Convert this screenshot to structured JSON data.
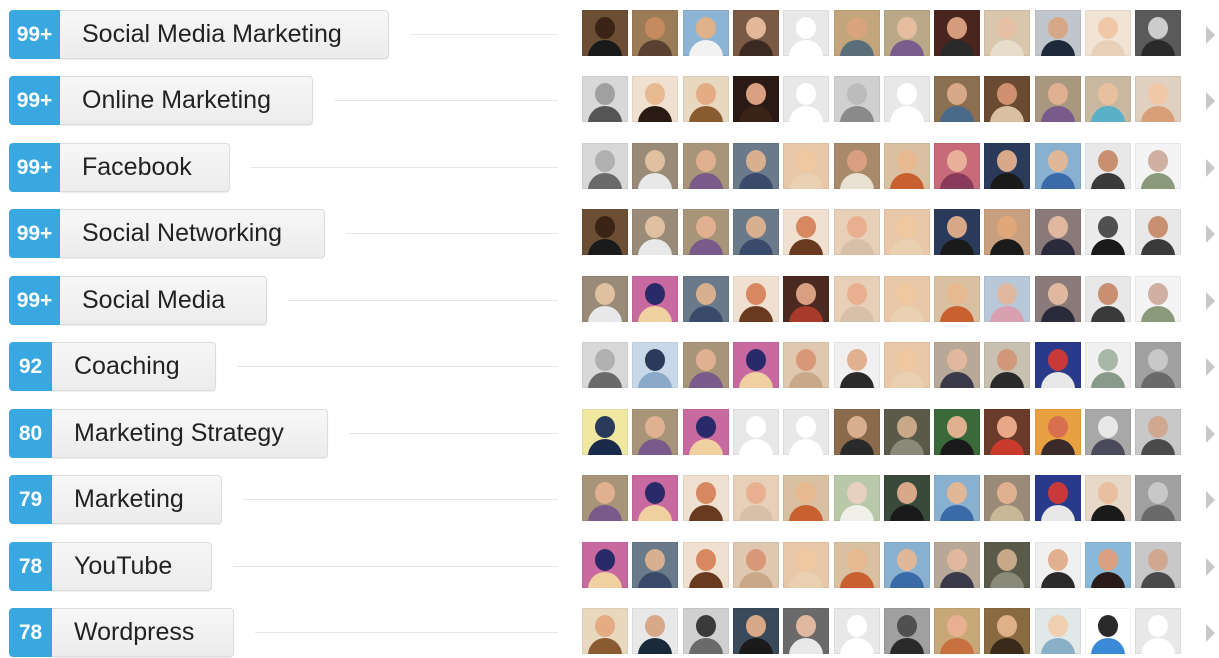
{
  "skills": [
    {
      "count": "99+",
      "name": "Social Media Marketing",
      "photos": [
        {
          "bg": "#6b4e34",
          "skin": "#3b2416",
          "shirt": "#1a1a1a"
        },
        {
          "bg": "#9c7b57",
          "skin": "#c68a5e",
          "shirt": "#5a4030"
        },
        {
          "bg": "#8db4d4",
          "skin": "#e0b28c",
          "shirt": "#f2f2f2"
        },
        {
          "bg": "#7a5a45",
          "skin": "#e2b79a",
          "shirt": "#3b2a22"
        },
        {
          "placeholder": true
        },
        {
          "bg": "#c4a47a",
          "skin": "#d8a47e",
          "shirt": "#5a6e7a"
        },
        {
          "bg": "#bba889",
          "skin": "#e5bea0",
          "shirt": "#7a5d8c"
        },
        {
          "bg": "#4a2520",
          "skin": "#d49c7c",
          "shirt": "#2a2a2a"
        },
        {
          "bg": "#d8c6ad",
          "skin": "#e6c0a4",
          "shirt": "#e8dccb"
        },
        {
          "bg": "#c0c6cc",
          "skin": "#d6a888",
          "shirt": "#1e2a3a"
        },
        {
          "bg": "#f2e4d4",
          "skin": "#f0c8a8",
          "shirt": "#e8d0b8"
        },
        {
          "bg": "#5a5a5a",
          "skin": "#cccccc",
          "shirt": "#2a2a2a"
        }
      ]
    },
    {
      "count": "99+",
      "name": "Online Marketing",
      "photos": [
        {
          "bg": "#d8d8d8",
          "skin": "#a0a0a0",
          "shirt": "#555555"
        },
        {
          "bg": "#f0e0d0",
          "skin": "#e8b890",
          "shirt": "#2a1a14"
        },
        {
          "bg": "#e8d8c0",
          "skin": "#e4ac84",
          "shirt": "#8a5a30"
        },
        {
          "bg": "#2a1a14",
          "skin": "#d8a080",
          "shirt": "#3a2418"
        },
        {
          "placeholder": true
        },
        {
          "bg": "#d0d0d0",
          "skin": "#bcbcbc",
          "shirt": "#8a8a8a"
        },
        {
          "placeholder": true
        },
        {
          "bg": "#8a7050",
          "skin": "#d8a888",
          "shirt": "#4a6a8a"
        },
        {
          "bg": "#6a4a30",
          "skin": "#d09070",
          "shirt": "#d8c0a0"
        },
        {
          "bg": "#a89880",
          "skin": "#e0b090",
          "shirt": "#7a5a8a"
        },
        {
          "bg": "#c8b8a0",
          "skin": "#e8c0a0",
          "shirt": "#5ab0c8"
        },
        {
          "bg": "#e0d0c0",
          "skin": "#f0c8a8",
          "shirt": "#d8a078"
        }
      ]
    },
    {
      "count": "99+",
      "name": "Facebook",
      "photos": [
        {
          "bg": "#d8d8d8",
          "skin": "#b0b0b0",
          "shirt": "#6a6a6a"
        },
        {
          "bg": "#9a8a78",
          "skin": "#e0c0a0",
          "shirt": "#e8e8e8"
        },
        {
          "bg": "#a89478",
          "skin": "#e0b090",
          "shirt": "#7a5a8a"
        },
        {
          "bg": "#6a7a8a",
          "skin": "#d8b090",
          "shirt": "#3a4a6a"
        },
        {
          "bg": "#e8c8a8",
          "skin": "#f0c8a0",
          "shirt": "#e8d0b0"
        },
        {
          "bg": "#a88a6a",
          "skin": "#d8a080",
          "shirt": "#e8e0d0"
        },
        {
          "bg": "#d8c0a0",
          "skin": "#e8b890",
          "shirt": "#c86030"
        },
        {
          "bg": "#c86a7a",
          "skin": "#e8b098",
          "shirt": "#8a3a5a"
        },
        {
          "bg": "#2a3a5a",
          "skin": "#d8a888",
          "shirt": "#1a1a1a"
        },
        {
          "bg": "#8ab0d0",
          "skin": "#e0b898",
          "shirt": "#3a6aa8"
        },
        {
          "bg": "#e8e8e8",
          "skin": "#c89070",
          "shirt": "#3a3a3a"
        },
        {
          "bg": "#f4f4f4",
          "skin": "#d0b0a0",
          "shirt": "#8a9a7a"
        }
      ]
    },
    {
      "count": "99+",
      "name": "Social Networking",
      "photos": [
        {
          "bg": "#6b4e34",
          "skin": "#3b2416",
          "shirt": "#1a1a1a"
        },
        {
          "bg": "#9a8a78",
          "skin": "#e0c0a0",
          "shirt": "#e8e8e8"
        },
        {
          "bg": "#a89478",
          "skin": "#e0b090",
          "shirt": "#7a5a8a"
        },
        {
          "bg": "#6a7a8a",
          "skin": "#d8b090",
          "shirt": "#3a4a6a"
        },
        {
          "bg": "#f0e0d0",
          "skin": "#d88860",
          "shirt": "#6a3a20"
        },
        {
          "bg": "#e8d0b8",
          "skin": "#e8b090",
          "shirt": "#d8c0a8"
        },
        {
          "bg": "#e8c8a8",
          "skin": "#f0c8a0",
          "shirt": "#e8d0b0"
        },
        {
          "bg": "#2a3a5a",
          "skin": "#d8a888",
          "shirt": "#1a1a1a"
        },
        {
          "bg": "#c8a080",
          "skin": "#e0a878",
          "shirt": "#1a1a1a"
        },
        {
          "bg": "#8a7a7a",
          "skin": "#e0b8a0",
          "shirt": "#2a2a3a"
        },
        {
          "bg": "#ececec",
          "skin": "#505050",
          "shirt": "#1a1a1a"
        },
        {
          "bg": "#e8e8e8",
          "skin": "#c89070",
          "shirt": "#3a3a3a"
        }
      ]
    },
    {
      "count": "99+",
      "name": "Social Media",
      "photos": [
        {
          "bg": "#9a8a78",
          "skin": "#e0c0a0",
          "shirt": "#e8e8e8"
        },
        {
          "bg": "#c86aa0",
          "skin": "#2a2a6a",
          "shirt": "#f0d0a0"
        },
        {
          "bg": "#6a7a8a",
          "skin": "#d8b090",
          "shirt": "#3a4a6a"
        },
        {
          "bg": "#f0e0d0",
          "skin": "#d88860",
          "shirt": "#6a3a20"
        },
        {
          "bg": "#4a2a20",
          "skin": "#d8a080",
          "shirt": "#a83a2a"
        },
        {
          "bg": "#e8d0b8",
          "skin": "#e8b090",
          "shirt": "#d8c0a8"
        },
        {
          "bg": "#e8c8a8",
          "skin": "#f0c8a0",
          "shirt": "#e8d0b0"
        },
        {
          "bg": "#d8c0a0",
          "skin": "#e8b890",
          "shirt": "#c86030"
        },
        {
          "bg": "#b8c8d8",
          "skin": "#e0b8a0",
          "shirt": "#d8a0b0"
        },
        {
          "bg": "#8a7a7a",
          "skin": "#e0b8a0",
          "shirt": "#2a2a3a"
        },
        {
          "bg": "#e8e8e8",
          "skin": "#c89070",
          "shirt": "#3a3a3a"
        },
        {
          "bg": "#f4f4f4",
          "skin": "#d0b0a0",
          "shirt": "#8a9a7a"
        }
      ]
    },
    {
      "count": "92",
      "name": "Coaching",
      "photos": [
        {
          "bg": "#d8d8d8",
          "skin": "#b0b0b0",
          "shirt": "#6a6a6a"
        },
        {
          "bg": "#c8d8e8",
          "skin": "#2a3a5a",
          "shirt": "#8aa8c8"
        },
        {
          "bg": "#a89478",
          "skin": "#e0b090",
          "shirt": "#7a5a8a"
        },
        {
          "bg": "#c86aa0",
          "skin": "#2a2a6a",
          "shirt": "#f0d0a0"
        },
        {
          "bg": "#e0c8b0",
          "skin": "#d89878",
          "shirt": "#c8a888"
        },
        {
          "bg": "#f0f0f0",
          "skin": "#e0b090",
          "shirt": "#2a2a2a"
        },
        {
          "bg": "#e8c8a8",
          "skin": "#f0c8a0",
          "shirt": "#e8d0b0"
        },
        {
          "bg": "#b8a898",
          "skin": "#e0b8a0",
          "shirt": "#3a3a4a"
        },
        {
          "bg": "#c8c0b0",
          "skin": "#d09878",
          "shirt": "#2a2a2a"
        },
        {
          "bg": "#2a3a8a",
          "skin": "#c83a3a",
          "shirt": "#e8e8e8"
        },
        {
          "bg": "#f0f0f0",
          "skin": "#a8b8a8",
          "shirt": "#8a9a8a"
        },
        {
          "bg": "#a0a0a0",
          "skin": "#c8c8c8",
          "shirt": "#6a6a6a"
        }
      ]
    },
    {
      "count": "80",
      "name": "Marketing Strategy",
      "photos": [
        {
          "bg": "#f0e8a0",
          "skin": "#2a3a5a",
          "shirt": "#1a2a4a"
        },
        {
          "bg": "#a89478",
          "skin": "#e0b090",
          "shirt": "#7a5a8a"
        },
        {
          "bg": "#c86aa0",
          "skin": "#2a2a6a",
          "shirt": "#f0d0a0"
        },
        {
          "placeholder": true
        },
        {
          "placeholder": true
        },
        {
          "bg": "#8a6a4a",
          "skin": "#d8b090",
          "shirt": "#2a2a2a"
        },
        {
          "bg": "#5a5a4a",
          "skin": "#c8a888",
          "shirt": "#8a8a7a"
        },
        {
          "bg": "#3a6a3a",
          "skin": "#e0b090",
          "shirt": "#1a1a1a"
        },
        {
          "bg": "#6a3a2a",
          "skin": "#e8a888",
          "shirt": "#c83a2a"
        },
        {
          "bg": "#e8a040",
          "skin": "#d87050",
          "shirt": "#3a2a2a"
        },
        {
          "bg": "#a8a8a8",
          "skin": "#e8e8e8",
          "shirt": "#4a4a5a"
        },
        {
          "bg": "#c8c8c8",
          "skin": "#d0a890",
          "shirt": "#4a4a4a"
        }
      ]
    },
    {
      "count": "79",
      "name": "Marketing",
      "photos": [
        {
          "bg": "#a89478",
          "skin": "#e0b090",
          "shirt": "#7a5a8a"
        },
        {
          "bg": "#c86aa0",
          "skin": "#2a2a6a",
          "shirt": "#f0d0a0"
        },
        {
          "bg": "#f0e0d0",
          "skin": "#d88860",
          "shirt": "#6a3a20"
        },
        {
          "bg": "#e8d0b8",
          "skin": "#e8b090",
          "shirt": "#d8c0a8"
        },
        {
          "bg": "#d8c0a0",
          "skin": "#e8b890",
          "shirt": "#c86030"
        },
        {
          "bg": "#b8c8a8",
          "skin": "#e8d0c0",
          "shirt": "#f0f0e8"
        },
        {
          "bg": "#3a4a3a",
          "skin": "#d8a888",
          "shirt": "#1a1a1a"
        },
        {
          "bg": "#8ab0d0",
          "skin": "#e0b898",
          "shirt": "#3a6aa8"
        },
        {
          "bg": "#9a8a78",
          "skin": "#e0b090",
          "shirt": "#c8b898"
        },
        {
          "bg": "#2a3a8a",
          "skin": "#c83a3a",
          "shirt": "#e8e8e8"
        },
        {
          "bg": "#e8d8c8",
          "skin": "#e8c0a0",
          "shirt": "#1a1a1a"
        },
        {
          "bg": "#a0a0a0",
          "skin": "#c8c8c8",
          "shirt": "#6a6a6a"
        }
      ]
    },
    {
      "count": "78",
      "name": "YouTube",
      "photos": [
        {
          "bg": "#c86aa0",
          "skin": "#2a2a6a",
          "shirt": "#f0d0a0"
        },
        {
          "bg": "#6a7a8a",
          "skin": "#d8b090",
          "shirt": "#3a4a6a"
        },
        {
          "bg": "#f0e0d0",
          "skin": "#d88860",
          "shirt": "#6a3a20"
        },
        {
          "bg": "#e0c8b0",
          "skin": "#d89878",
          "shirt": "#c8a888"
        },
        {
          "bg": "#e8c8a8",
          "skin": "#f0c8a0",
          "shirt": "#e8d0b0"
        },
        {
          "bg": "#d8c0a0",
          "skin": "#e8b890",
          "shirt": "#c86030"
        },
        {
          "bg": "#8ab0d0",
          "skin": "#e0b898",
          "shirt": "#3a6aa8"
        },
        {
          "bg": "#b8a898",
          "skin": "#e0b8a0",
          "shirt": "#3a3a4a"
        },
        {
          "bg": "#5a5a4a",
          "skin": "#c8a888",
          "shirt": "#8a8a7a"
        },
        {
          "bg": "#f0f0f0",
          "skin": "#e0b090",
          "shirt": "#2a2a2a"
        },
        {
          "bg": "#8ab8d8",
          "skin": "#d8a080",
          "shirt": "#2a1a1a"
        },
        {
          "bg": "#c8c8c8",
          "skin": "#d0a890",
          "shirt": "#4a4a4a"
        }
      ]
    },
    {
      "count": "78",
      "name": "Wordpress",
      "photos": [
        {
          "bg": "#e8d8c0",
          "skin": "#e4ac84",
          "shirt": "#8a5a30"
        },
        {
          "bg": "#e8e8e8",
          "skin": "#d8a888",
          "shirt": "#1a2a3a"
        },
        {
          "bg": "#d0d0d0",
          "skin": "#3a3a3a",
          "shirt": "#6a6a6a"
        },
        {
          "bg": "#3a4a5a",
          "skin": "#d8a888",
          "shirt": "#1a1a1a"
        },
        {
          "bg": "#6a6a6a",
          "skin": "#e0b8a0",
          "shirt": "#e8e8e8"
        },
        {
          "placeholder": true
        },
        {
          "bg": "#a0a0a0",
          "skin": "#505050",
          "shirt": "#2a2a2a"
        },
        {
          "bg": "#c8a878",
          "skin": "#e8b090",
          "shirt": "#c87040"
        },
        {
          "bg": "#8a6a40",
          "skin": "#e0b088",
          "shirt": "#3a2a1a"
        },
        {
          "bg": "#e0e8e8",
          "skin": "#f0d0b0",
          "shirt": "#8ab0c8"
        },
        {
          "bg": "#ffffff",
          "skin": "#2a2a2a",
          "shirt": "#3a8ad8"
        },
        {
          "placeholder": true
        }
      ]
    }
  ]
}
